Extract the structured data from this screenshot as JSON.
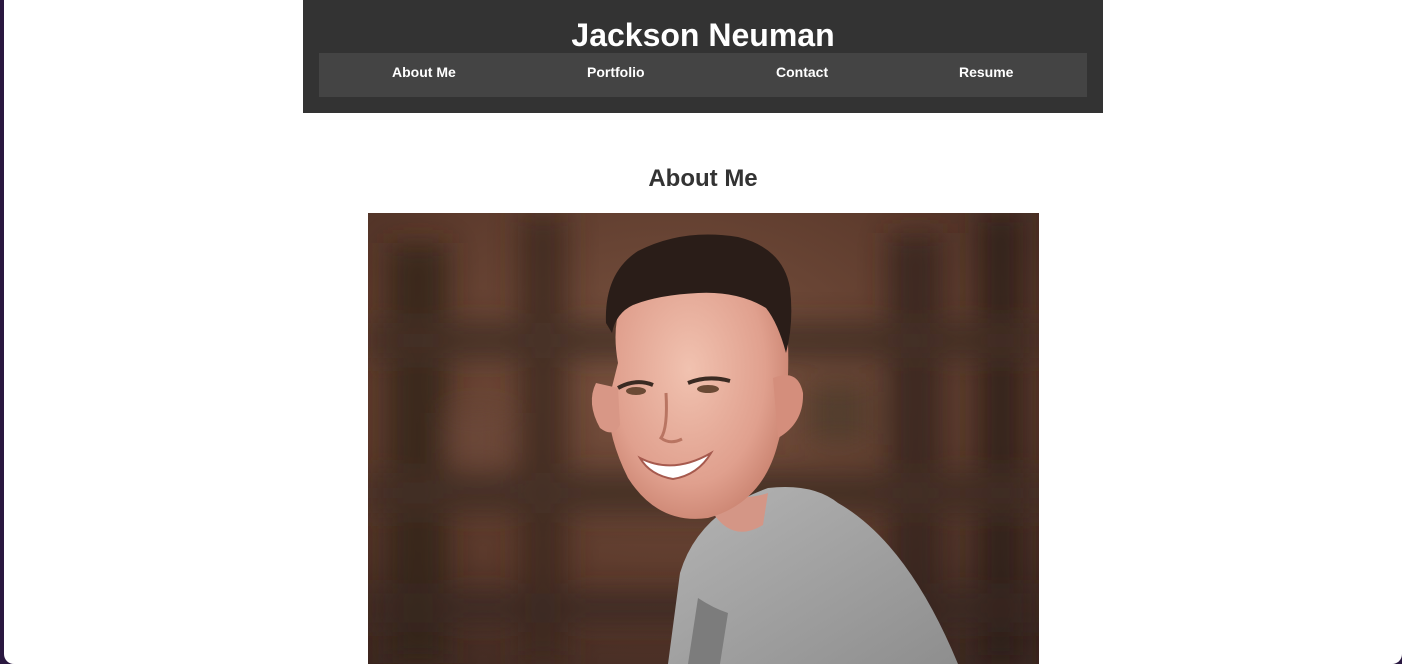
{
  "header": {
    "title": "Jackson Neuman"
  },
  "nav": {
    "items": [
      {
        "label": "About Me"
      },
      {
        "label": "Portfolio"
      },
      {
        "label": "Contact"
      },
      {
        "label": "Resume"
      }
    ]
  },
  "about": {
    "heading": "About Me"
  },
  "colors": {
    "header_bg": "#333333",
    "nav_bg": "#444444",
    "text_light": "#ffffff",
    "text_dark": "#333333"
  }
}
